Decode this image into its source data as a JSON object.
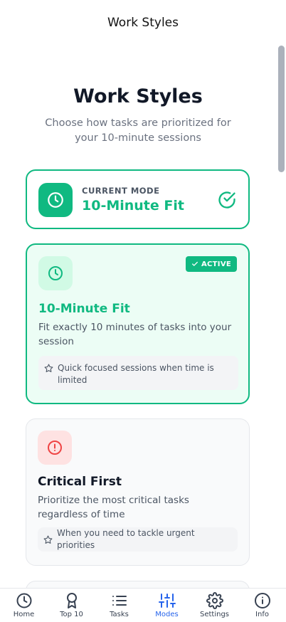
{
  "header": {
    "title": "Work Styles"
  },
  "page": {
    "title": "Work Styles",
    "subtitle": "Choose how tasks are prioritized for your 10-minute sessions"
  },
  "current_mode": {
    "eyebrow": "CURRENT MODE",
    "name": "10-Minute Fit",
    "icon": "clock-icon"
  },
  "modes": [
    {
      "name": "10-Minute Fit",
      "description": "Fit exactly 10 minutes of tasks into your session",
      "tip": "Quick focused sessions when time is limited",
      "badge": "ACTIVE",
      "icon": "clock-icon",
      "active": true
    },
    {
      "name": "Critical First",
      "description": "Prioritize the most critical tasks regardless of time",
      "tip": "When you need to tackle urgent priorities",
      "icon": "alert-circle-icon",
      "active": false
    }
  ],
  "tabs": [
    {
      "label": "Home",
      "icon": "clock-icon"
    },
    {
      "label": "Top 10",
      "icon": "award-icon"
    },
    {
      "label": "Tasks",
      "icon": "list-icon"
    },
    {
      "label": "Modes",
      "icon": "sliders-icon",
      "active": true
    },
    {
      "label": "Settings",
      "icon": "gear-icon"
    },
    {
      "label": "Info",
      "icon": "info-icon"
    }
  ],
  "colors": {
    "accent": "#10b981",
    "accent_light": "#ecfdf5",
    "danger": "#ef4444",
    "tab_active": "#2563eb"
  }
}
